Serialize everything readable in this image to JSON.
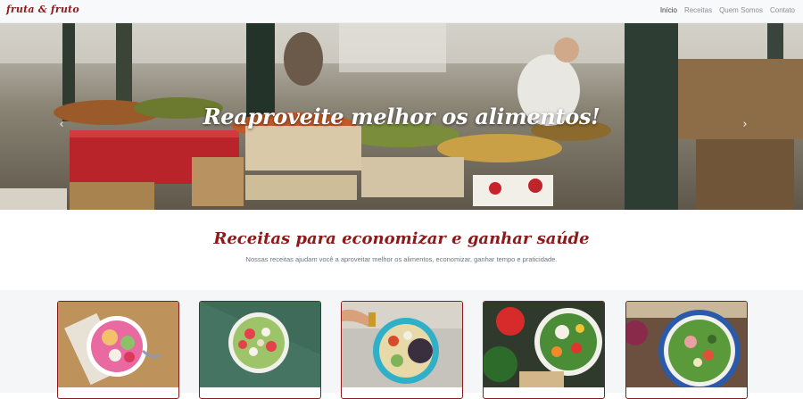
{
  "navbar": {
    "brand": "fruta & fruto",
    "links": [
      {
        "label": "Início",
        "active": true
      },
      {
        "label": "Receitas",
        "active": false
      },
      {
        "label": "Quem Somos",
        "active": false
      },
      {
        "label": "Contato",
        "active": false
      }
    ]
  },
  "hero": {
    "title": "Reaproveite melhor os alimentos!",
    "prev_icon": "chevron-left-icon",
    "next_icon": "chevron-right-icon"
  },
  "intro": {
    "title": "Receitas para economizar e ganhar saúde",
    "subtitle": "Nossas receitas ajudam você a aproveitar melhor os alimentos, economizar, ganhar tempo e praticidade."
  },
  "colors": {
    "brand": "#8b1a1a",
    "navbar_bg": "#f8f9fa",
    "cards_bg": "#f5f6f8"
  },
  "cards": [
    {
      "image": "fruit-smoothie-bowl-photo"
    },
    {
      "image": "kiwi-strawberry-bowl-photo"
    },
    {
      "image": "quinoa-salad-plate-photo"
    },
    {
      "image": "mixed-vegetable-salad-photo"
    },
    {
      "image": "green-salad-bowl-photo"
    }
  ]
}
